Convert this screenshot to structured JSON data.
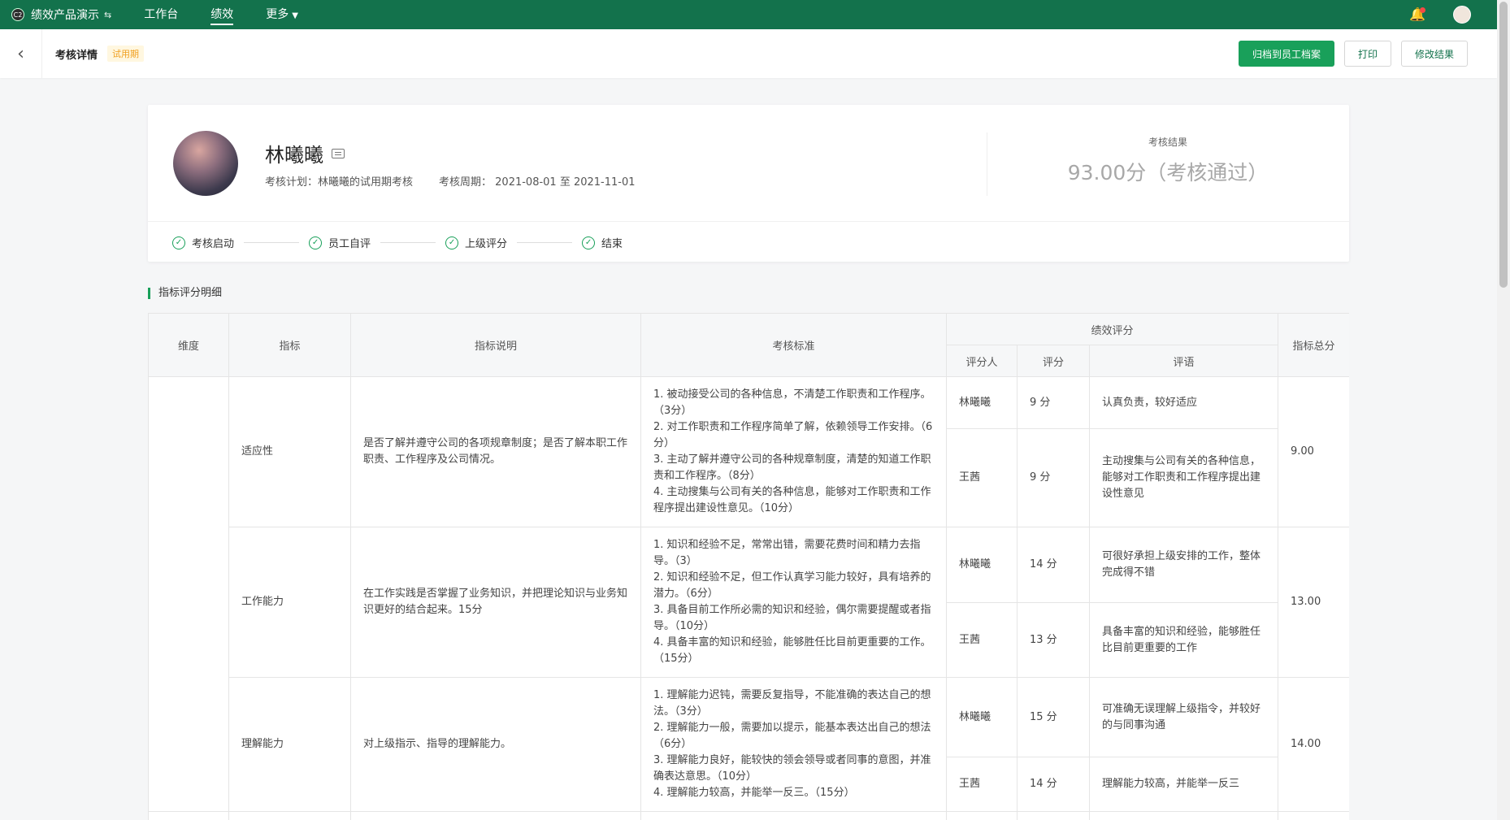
{
  "topbar": {
    "brand": "绩效产品演示",
    "brand_logo": "C2",
    "nav": [
      {
        "label": "工作台"
      },
      {
        "label": "绩效"
      },
      {
        "label": "更多"
      }
    ],
    "bell_glyph": "🔔"
  },
  "header": {
    "back_glyph": "‹",
    "title": "考核详情",
    "badge": "试用期",
    "buttons": {
      "archive": "归档到员工档案",
      "print": "打印",
      "modify": "修改结果"
    }
  },
  "profile": {
    "name": "林曦曦",
    "plan": "考核计划：林曦曦的试用期考核",
    "period": "考核周期： 2021-08-01 至 2021-11-01",
    "result_label": "考核结果",
    "result_value": "93.00分（考核通过）",
    "steps": [
      "考核启动",
      "员工自评",
      "上级评分",
      "结束"
    ]
  },
  "section": {
    "title": "指标评分明细"
  },
  "table": {
    "headers": {
      "dimension": "维度",
      "indicator": "指标",
      "description": "指标说明",
      "standard": "考核标准",
      "rating_group": "绩效评分",
      "rater": "评分人",
      "score": "评分",
      "comment": "评语",
      "total": "指标总分"
    },
    "rows": [
      {
        "indicator": "适应性",
        "description": "是否了解并遵守公司的各项规章制度；是否了解本职工作职责、工作程序及公司情况。",
        "standard": [
          "1. 被动接受公司的各种信息，不清楚工作职责和工作程序。（3分）",
          "2. 对工作职责和工作程序简单了解，依赖领导工作安排。（6分）",
          "3. 主动了解并遵守公司的各种规章制度，清楚的知道工作职责和工作程序。（8分）",
          "4. 主动搜集与公司有关的各种信息，能够对工作职责和工作程序提出建设性意见。（10分）"
        ],
        "ratings": [
          {
            "rater": "林曦曦",
            "score": "9 分",
            "comment": "认真负责，较好适应"
          },
          {
            "rater": "王茜",
            "score": "9 分",
            "comment": "主动搜集与公司有关的各种信息，能够对工作职责和工作程序提出建设性意见"
          }
        ],
        "total": "9.00"
      },
      {
        "indicator": "工作能力",
        "description": "在工作实践是否掌握了业务知识，并把理论知识与业务知识更好的结合起来。15分",
        "standard": [
          "1. 知识和经验不足，常常出错，需要花费时间和精力去指导。（3）",
          "2. 知识和经验不足，但工作认真学习能力较好，具有培养的潜力。（6分）",
          "3. 具备目前工作所必需的知识和经验，偶尔需要提醒或者指导。（10分）",
          "4. 具备丰富的知识和经验，能够胜任比目前更重要的工作。（15分）"
        ],
        "ratings": [
          {
            "rater": "林曦曦",
            "score": "14 分",
            "comment": "可很好承担上级安排的工作，整体完成得不错"
          },
          {
            "rater": "王茜",
            "score": "13 分",
            "comment": "具备丰富的知识和经验，能够胜任比目前更重要的工作"
          }
        ],
        "total": "13.00"
      },
      {
        "indicator": "理解能力",
        "description": "对上级指示、指导的理解能力。",
        "standard": [
          "1. 理解能力迟钝，需要反复指导，不能准确的表达自己的想法。（3分）",
          "2. 理解能力一般，需要加以提示，能基本表达出自己的想法（6分）",
          "3. 理解能力良好，能较快的领会领导或者同事的意图，并准确表达意思。（10分）",
          "4. 理解能力较高，并能举一反三。（15分）"
        ],
        "ratings": [
          {
            "rater": "林曦曦",
            "score": "15 分",
            "comment": "可准确无误理解上级指令，并较好的与同事沟通"
          },
          {
            "rater": "王茜",
            "score": "14 分",
            "comment": "理解能力较高，并能举一反三"
          }
        ],
        "total": "14.00"
      }
    ]
  }
}
